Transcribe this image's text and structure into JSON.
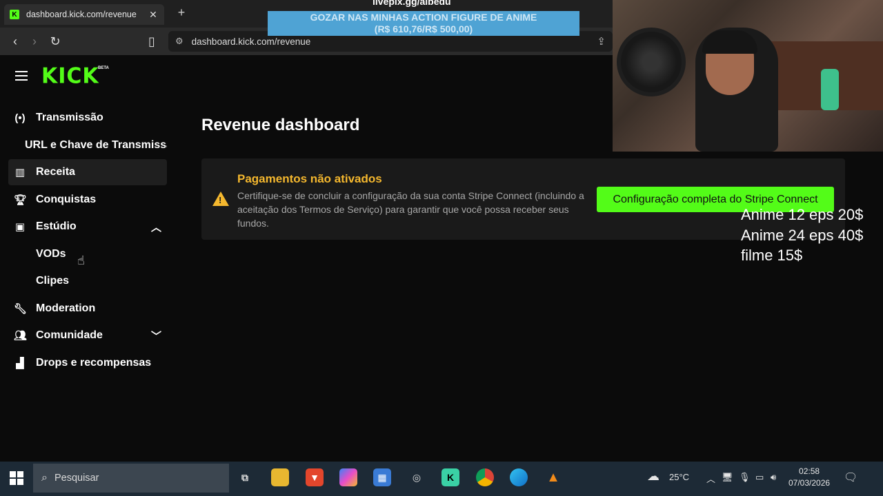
{
  "browser": {
    "tab_title": "dashboard.kick.com/revenue",
    "tab_close": "✕",
    "new_tab": "+",
    "url": "dashboard.kick.com/revenue"
  },
  "overlay": {
    "livepix": "livepix.gg/albedu",
    "goal_line1": "GOZAR NAS MINHAS ACTION FIGURE DE ANIME",
    "goal_line2": "(R$ 610,76/R$ 500,00)",
    "price_list": [
      "Anime 12 eps 20$",
      "Anime 24 eps 40$",
      "filme 15$"
    ]
  },
  "app": {
    "logo": "KICK",
    "beta": "BETA"
  },
  "sidebar": {
    "items": [
      {
        "label": "Transmissão",
        "icon": "broadcast-icon"
      },
      {
        "label": "URL e Chave de Transmissão"
      },
      {
        "label": "Receita",
        "icon": "chart-icon",
        "active": true
      },
      {
        "label": "Conquistas",
        "icon": "trophy-icon"
      },
      {
        "label": "Estúdio",
        "icon": "studio-icon",
        "expanded": true
      },
      {
        "label": "VODs"
      },
      {
        "label": "Clipes"
      },
      {
        "label": "Moderation",
        "icon": "wrench-icon"
      },
      {
        "label": "Comunidade",
        "icon": "users-icon",
        "expanded": false
      },
      {
        "label": "Drops e recompensas",
        "icon": "drops-icon"
      }
    ]
  },
  "main": {
    "title": "Revenue dashboard",
    "alert": {
      "title": "Pagamentos não ativados",
      "body": "Certifique-se de concluir a configuração da sua conta Stripe Connect (incluindo a aceitação dos Termos de Serviço) para garantir que você possa receber seus fundos.",
      "button": "Configuração completa do Stripe Connect"
    }
  },
  "taskbar": {
    "search_placeholder": "Pesquisar",
    "temperature": "25°C",
    "time": "02:58",
    "date": "07/03/2026"
  },
  "colors": {
    "brand": "#53fc18",
    "warning": "#f5b82e",
    "goal_banner": "#4fa3d4"
  }
}
